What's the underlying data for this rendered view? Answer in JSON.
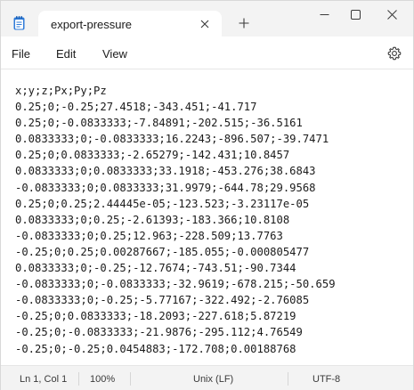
{
  "window": {
    "tab_title": "export-pressure",
    "icons": {
      "app": "notepad-icon",
      "close_tab": "close-icon",
      "new_tab": "plus-icon",
      "minimize": "minimize-icon",
      "maximize": "maximize-icon",
      "close_window": "close-icon"
    }
  },
  "menu": {
    "file": "File",
    "edit": "Edit",
    "view": "View",
    "settings_icon": "gear-icon"
  },
  "editor": {
    "lines": [
      "x;y;z;Px;Py;Pz",
      "0.25;0;-0.25;27.4518;-343.451;-41.717",
      "0.25;0;-0.0833333;-7.84891;-202.515;-36.5161",
      "0.0833333;0;-0.0833333;16.2243;-896.507;-39.7471",
      "0.25;0;0.0833333;-2.65279;-142.431;10.8457",
      "0.0833333;0;0.0833333;33.1918;-453.276;38.6843",
      "-0.0833333;0;0.0833333;31.9979;-644.78;29.9568",
      "0.25;0;0.25;2.44445e-05;-123.523;-3.23117e-05",
      "0.0833333;0;0.25;-2.61393;-183.366;10.8108",
      "-0.0833333;0;0.25;12.963;-228.509;13.7763",
      "-0.25;0;0.25;0.00287667;-185.055;-0.000805477",
      "0.0833333;0;-0.25;-12.7674;-743.51;-90.7344",
      "-0.0833333;0;-0.0833333;-32.9619;-678.215;-50.659",
      "-0.0833333;0;-0.25;-5.77167;-322.492;-2.76085",
      "-0.25;0;0.0833333;-18.2093;-227.618;5.87219",
      "-0.25;0;-0.0833333;-21.9876;-295.112;4.76549",
      "-0.25;0;-0.25;0.0454883;-172.708;0.00188768"
    ]
  },
  "status": {
    "position": "Ln 1, Col 1",
    "zoom": "100%",
    "line_ending": "Unix (LF)",
    "encoding": "UTF-8"
  },
  "colors": {
    "titlebar_bg": "#f3f3f3",
    "app_icon_blue": "#2f7bd8"
  }
}
